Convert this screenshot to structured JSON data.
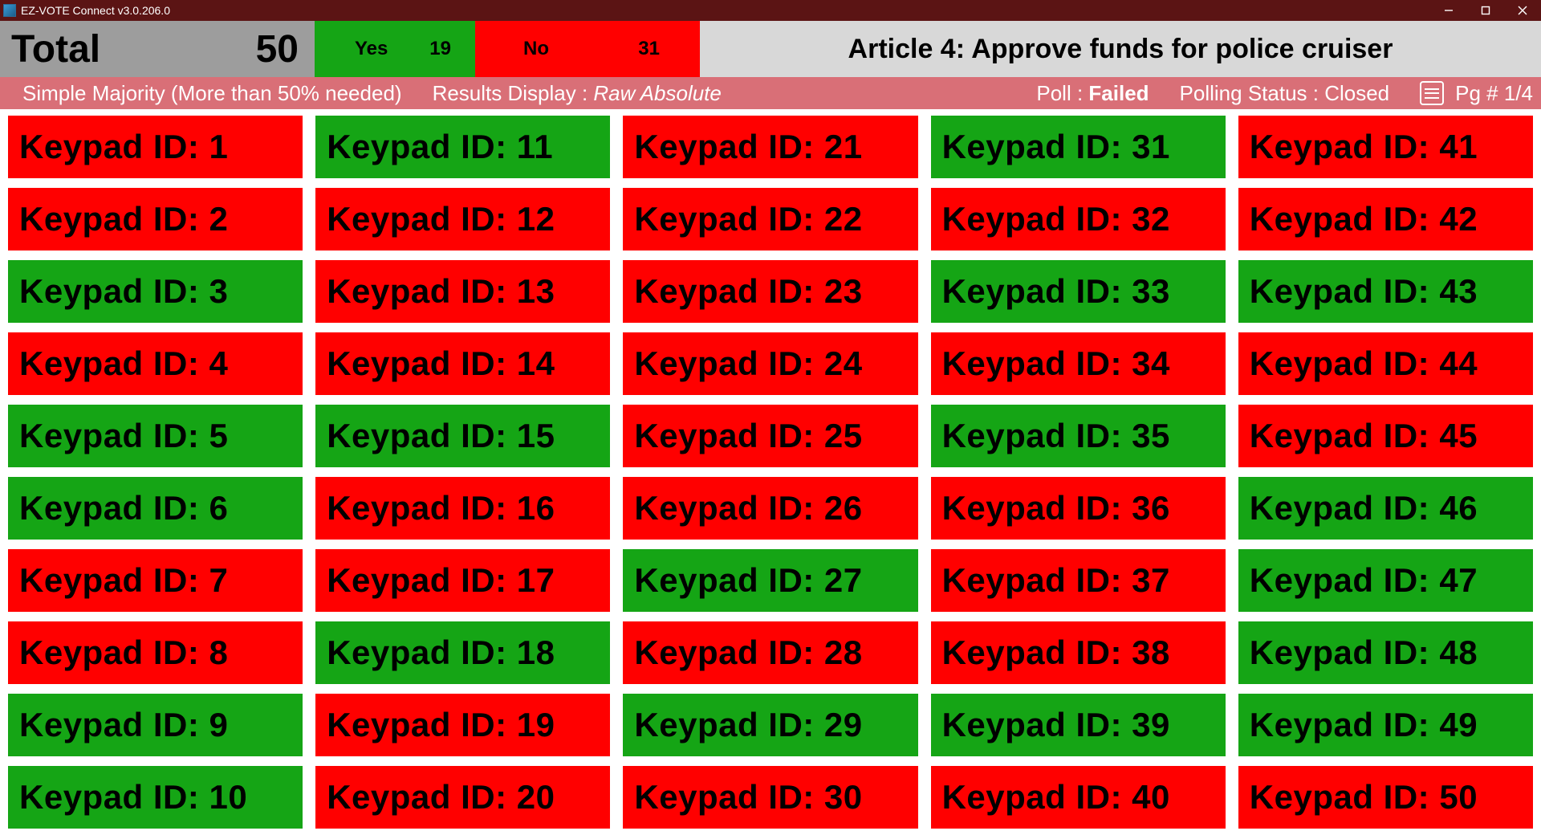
{
  "window": {
    "title": "EZ-VOTE Connect v3.0.206.0"
  },
  "summary": {
    "total_label": "Total",
    "total_value": "50",
    "yes_label": "Yes",
    "yes_value": "19",
    "no_label": "No",
    "no_value": "31",
    "question": "Article 4: Approve funds for police cruiser"
  },
  "info": {
    "majority_rule": "Simple Majority (More than 50% needed)",
    "results_label": "Results Display : ",
    "results_mode": "Raw Absolute",
    "poll_label": "Poll : ",
    "poll_result": "Failed",
    "status_label": "Polling Status : ",
    "status_value": "Closed",
    "page_label": "Pg # 1/4"
  },
  "keypad_prefix": "Keypad ID: ",
  "keypads": [
    {
      "id": 1,
      "vote": "no"
    },
    {
      "id": 2,
      "vote": "no"
    },
    {
      "id": 3,
      "vote": "yes"
    },
    {
      "id": 4,
      "vote": "no"
    },
    {
      "id": 5,
      "vote": "yes"
    },
    {
      "id": 6,
      "vote": "yes"
    },
    {
      "id": 7,
      "vote": "no"
    },
    {
      "id": 8,
      "vote": "no"
    },
    {
      "id": 9,
      "vote": "yes"
    },
    {
      "id": 10,
      "vote": "yes"
    },
    {
      "id": 11,
      "vote": "yes"
    },
    {
      "id": 12,
      "vote": "no"
    },
    {
      "id": 13,
      "vote": "no"
    },
    {
      "id": 14,
      "vote": "no"
    },
    {
      "id": 15,
      "vote": "yes"
    },
    {
      "id": 16,
      "vote": "no"
    },
    {
      "id": 17,
      "vote": "no"
    },
    {
      "id": 18,
      "vote": "yes"
    },
    {
      "id": 19,
      "vote": "no"
    },
    {
      "id": 20,
      "vote": "no"
    },
    {
      "id": 21,
      "vote": "no"
    },
    {
      "id": 22,
      "vote": "no"
    },
    {
      "id": 23,
      "vote": "no"
    },
    {
      "id": 24,
      "vote": "no"
    },
    {
      "id": 25,
      "vote": "no"
    },
    {
      "id": 26,
      "vote": "no"
    },
    {
      "id": 27,
      "vote": "yes"
    },
    {
      "id": 28,
      "vote": "no"
    },
    {
      "id": 29,
      "vote": "yes"
    },
    {
      "id": 30,
      "vote": "no"
    },
    {
      "id": 31,
      "vote": "yes"
    },
    {
      "id": 32,
      "vote": "no"
    },
    {
      "id": 33,
      "vote": "yes"
    },
    {
      "id": 34,
      "vote": "no"
    },
    {
      "id": 35,
      "vote": "yes"
    },
    {
      "id": 36,
      "vote": "no"
    },
    {
      "id": 37,
      "vote": "no"
    },
    {
      "id": 38,
      "vote": "no"
    },
    {
      "id": 39,
      "vote": "yes"
    },
    {
      "id": 40,
      "vote": "no"
    },
    {
      "id": 41,
      "vote": "no"
    },
    {
      "id": 42,
      "vote": "no"
    },
    {
      "id": 43,
      "vote": "yes"
    },
    {
      "id": 44,
      "vote": "no"
    },
    {
      "id": 45,
      "vote": "no"
    },
    {
      "id": 46,
      "vote": "yes"
    },
    {
      "id": 47,
      "vote": "yes"
    },
    {
      "id": 48,
      "vote": "yes"
    },
    {
      "id": 49,
      "vote": "yes"
    },
    {
      "id": 50,
      "vote": "no"
    }
  ],
  "colors": {
    "yes": "#15a515",
    "no": "#ff0000",
    "titlebar": "#5b1414",
    "infobar": "#d96f77",
    "total_bg": "#9d9d9d",
    "question_bg": "#d8d8d8"
  }
}
